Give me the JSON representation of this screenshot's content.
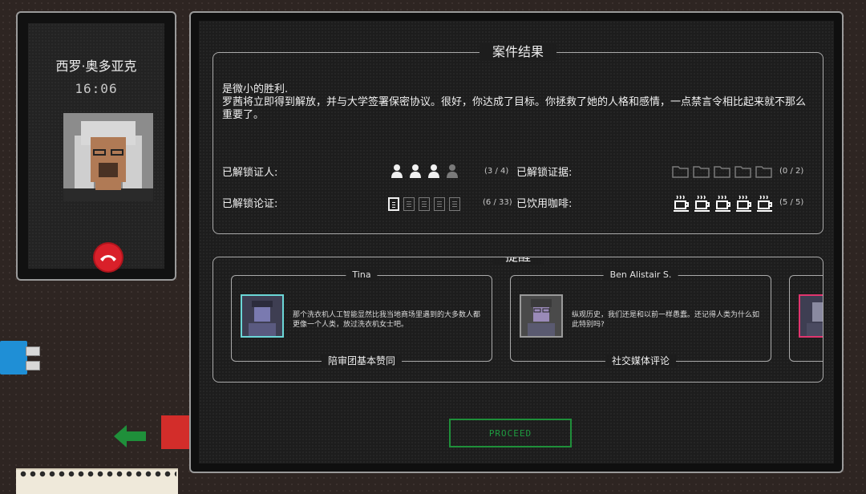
{
  "phone": {
    "caller_name": "西罗·奥多亚克",
    "call_time": "16:06",
    "hangup_icon": "phone-hangup-icon"
  },
  "results": {
    "title": "案件结果",
    "headline": "是微小的胜利.",
    "body": "罗茜将立即得到解放，并与大学签署保密协议。很好，你达成了目标。你拯救了她的人格和感情，一点禁言令相比起来就不那么重要了。",
    "stats": {
      "witnesses": {
        "label": "已解锁证人:",
        "count": "(3 / 4)",
        "unlocked": 3,
        "total_icons": 4,
        "icon": "person-icon"
      },
      "arguments": {
        "label": "已解锁论证:",
        "count": "(6 / 33)",
        "unlocked": 6,
        "total": 33,
        "icon": "document-icon"
      },
      "evidence": {
        "label": "已解锁证据:",
        "count": "(0 / 2)",
        "unlocked": 0,
        "total": 2,
        "icon": "folder-icon"
      },
      "coffee": {
        "label": "已饮用咖啡:",
        "count": "(5 / 5)",
        "unlocked": 5,
        "total": 5,
        "icon": "coffee-cup-icon"
      }
    }
  },
  "reminders": {
    "title": "提醒",
    "cards": [
      {
        "name": "Tina",
        "text": "那个洗衣机人工智能显然比我当地商场里遇到的大多数人都更像一个人类，放过洗衣机女士吧。",
        "tag": "陪审团基本赞同",
        "accent": "#6bd6d6"
      },
      {
        "name": "Ben Alistair S.",
        "text": "纵观历史，我们还是和以前一样愚蠢。还记得人类为什么如此特别吗?",
        "tag": "社交媒体评论",
        "accent": "#9a9a9a"
      },
      {
        "name": "",
        "text": "",
        "tag": "",
        "accent": "#e0356e"
      }
    ]
  },
  "proceed_label": "PROCEED",
  "colors": {
    "accent_green": "#1f8f3a",
    "hangup_red": "#d9202a",
    "usb_blue": "#1f8fd6"
  }
}
